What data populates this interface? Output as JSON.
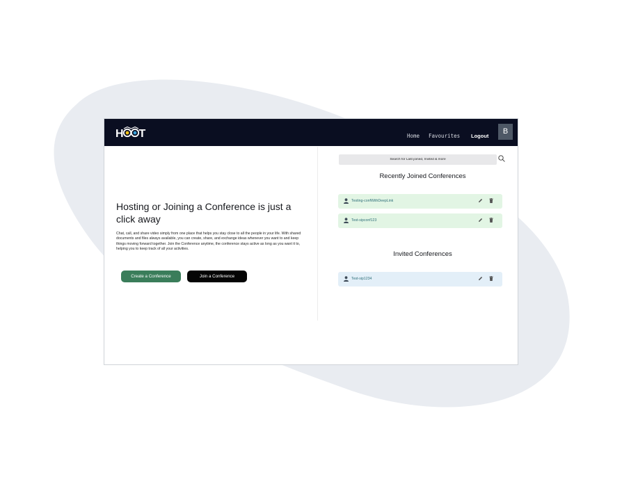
{
  "colors": {
    "navbar_bg": "#0a0e21",
    "create_button_bg": "#3a7d5a",
    "join_button_bg": "#050505",
    "recent_card_bg": "#e2f5e4",
    "invited_card_bg": "#e3eff8",
    "avatar_bg": "#4e5866",
    "backdrop_blob": "#e9ecf1"
  },
  "navbar": {
    "logo": {
      "text": "HOOT",
      "icon": "owl-eyes-logo"
    },
    "links": {
      "home": "Home",
      "favourites": "Favourites",
      "logout": "Logout"
    },
    "avatar_initial": "B"
  },
  "hero": {
    "title": "Hosting or Joining a Conference is just a click away",
    "description": "Chat, call, and share video simply from one place that helps you stay close to all the people in your life. With shared documents and files always available, you can create, share, and exchange ideas whenever you want to and keep things moving forward together. Join the Conference anytime, the conference stays active as long as you want it to, helping you to keep track of all your activities.",
    "create_button": "Create a Conference",
    "join_button": "Join a Conference"
  },
  "search": {
    "placeholder": "Search for Last joined, Invited & more",
    "icon": "search-icon"
  },
  "recent": {
    "title": "Recently Joined Conferences",
    "items": [
      {
        "name": "Testing-confWithDeepLink",
        "icons": [
          "user-icon",
          "edit-icon",
          "trash-icon"
        ]
      },
      {
        "name": "Test-sipconf123",
        "icons": [
          "user-icon",
          "edit-icon",
          "trash-icon"
        ]
      }
    ]
  },
  "invited": {
    "title": "Invited Conferences",
    "items": [
      {
        "name": "Test-sip1234",
        "icons": [
          "user-icon",
          "edit-icon",
          "trash-icon"
        ]
      }
    ]
  }
}
